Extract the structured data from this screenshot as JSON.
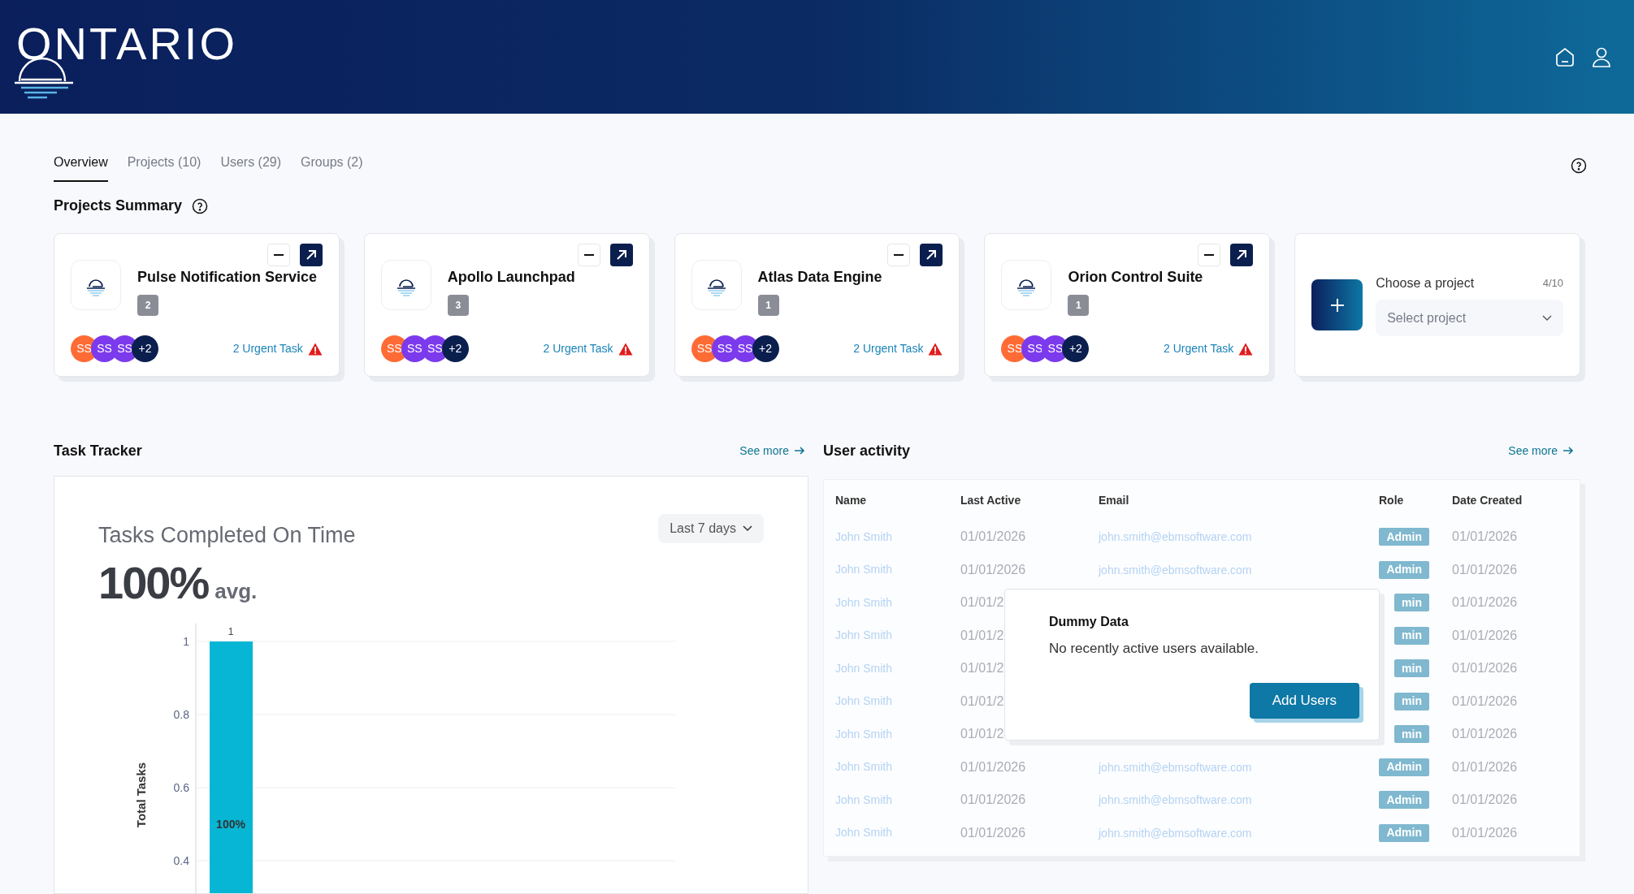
{
  "header": {
    "logo": "ONTARIO"
  },
  "tabs": [
    {
      "label": "Overview",
      "selected": true
    },
    {
      "label": "Projects (10)",
      "selected": false
    },
    {
      "label": "Users (29)",
      "selected": false
    },
    {
      "label": "Groups (2)",
      "selected": false
    }
  ],
  "projects_summary": {
    "title": "Projects Summary",
    "projects": [
      {
        "name": "Pulse Notification Service",
        "count": "2",
        "avatars": [
          {
            "initials": "SS",
            "color": "#ff6b35"
          },
          {
            "initials": "SS",
            "color": "#7c3aed"
          },
          {
            "initials": "SS",
            "color": "#7c3aed"
          },
          {
            "initials": "+2",
            "color": "#0b1f4f"
          }
        ],
        "urgent": "2 Urgent Task"
      },
      {
        "name": "Apollo Launchpad",
        "count": "3",
        "avatars": [
          {
            "initials": "SS",
            "color": "#ff6b35"
          },
          {
            "initials": "SS",
            "color": "#7c3aed"
          },
          {
            "initials": "SS",
            "color": "#7c3aed"
          },
          {
            "initials": "+2",
            "color": "#0b1f4f"
          }
        ],
        "urgent": "2 Urgent Task"
      },
      {
        "name": "Atlas Data Engine",
        "count": "1",
        "avatars": [
          {
            "initials": "SS",
            "color": "#ff6b35"
          },
          {
            "initials": "SS",
            "color": "#7c3aed"
          },
          {
            "initials": "SS",
            "color": "#7c3aed"
          },
          {
            "initials": "+2",
            "color": "#0b1f4f"
          }
        ],
        "urgent": "2 Urgent Task"
      },
      {
        "name": "Orion Control Suite",
        "count": "1",
        "avatars": [
          {
            "initials": "SS",
            "color": "#ff6b35"
          },
          {
            "initials": "SS",
            "color": "#7c3aed"
          },
          {
            "initials": "SS",
            "color": "#7c3aed"
          },
          {
            "initials": "+2",
            "color": "#0b1f4f"
          }
        ],
        "urgent": "2 Urgent Task"
      }
    ],
    "chooser": {
      "label": "Choose a project",
      "count": "4/10",
      "placeholder": "Select project"
    }
  },
  "task_tracker": {
    "title": "Task Tracker",
    "see_more": "See more",
    "chart_title": "Tasks Completed On Time",
    "big_value": "100%",
    "big_suffix": "avg.",
    "range": "Last 7 days",
    "chart_data": {
      "type": "bar",
      "ylabel": "Total Tasks",
      "values": [
        1
      ],
      "ylim": [
        0,
        1.05
      ],
      "grid": true,
      "yticks": [
        0.4,
        0.6,
        0.8,
        1
      ],
      "data_labels": true,
      "annotations": [
        "100%"
      ]
    }
  },
  "user_activity": {
    "title": "User activity",
    "see_more": "See more",
    "columns": [
      "Name",
      "Last Active",
      "Email",
      "Role",
      "Date Created"
    ],
    "rows": [
      {
        "name": "John Smith",
        "last_active": "01/01/2026",
        "email": "john.smith@ebmsoftware.com",
        "role": "Admin",
        "date_created": "01/01/2026"
      },
      {
        "name": "John Smith",
        "last_active": "01/01/2026",
        "email": "john.smith@ebmsoftware.com",
        "role": "Admin",
        "date_created": "01/01/2026"
      },
      {
        "name": "John Smith",
        "last_active": "01/01/2",
        "role": "min",
        "date_created": "01/01/2026"
      },
      {
        "name": "John Smith",
        "last_active": "01/01/2",
        "role": "min",
        "date_created": "01/01/2026"
      },
      {
        "name": "John Smith",
        "last_active": "01/01/2",
        "role": "min",
        "date_created": "01/01/2026"
      },
      {
        "name": "John Smith",
        "last_active": "01/01/2",
        "role": "min",
        "date_created": "01/01/2026"
      },
      {
        "name": "John Smith",
        "last_active": "01/01/2",
        "role": "min",
        "date_created": "01/01/2026"
      },
      {
        "name": "John Smith",
        "last_active": "01/01/2026",
        "email": "john.smith@ebmsoftware.com",
        "role": "Admin",
        "date_created": "01/01/2026"
      },
      {
        "name": "John Smith",
        "last_active": "01/01/2026",
        "email": "john.smith@ebmsoftware.com",
        "role": "Admin",
        "date_created": "01/01/2026"
      },
      {
        "name": "John Smith",
        "last_active": "01/01/2026",
        "email": "john.smith@ebmsoftware.com",
        "role": "Admin",
        "date_created": "01/01/2026"
      }
    ],
    "overlay": {
      "title": "Dummy Data",
      "message": "No recently active users available.",
      "button": "Add Users"
    }
  }
}
